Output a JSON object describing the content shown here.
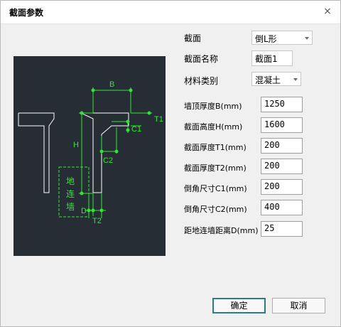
{
  "window": {
    "title": "截面参数",
    "close_glyph": "×"
  },
  "diagram": {
    "label_b": "B",
    "label_h": "H",
    "label_t1": "T1",
    "label_t2": "T2",
    "label_c1": "C1",
    "label_c2": "C2",
    "label_d": "D",
    "wall_chars": [
      "地",
      "连",
      "墙"
    ],
    "colors": {
      "background": "#262d35",
      "outline": "#ffffff",
      "dimension": "#33e533"
    }
  },
  "form": {
    "section_label": "截面",
    "section_value": "倒L形",
    "name_label": "截面名称",
    "name_value": "截面1",
    "material_label": "材料类别",
    "material_value": "混凝土",
    "fields": [
      {
        "label": "墙顶厚度B(mm)",
        "value": "1250"
      },
      {
        "label": "截面高度H(mm)",
        "value": "1600"
      },
      {
        "label": "截面厚度T1(mm)",
        "value": "200"
      },
      {
        "label": "截面厚度T2(mm)",
        "value": "200"
      },
      {
        "label": "倒角尺寸C1(mm)",
        "value": "200"
      },
      {
        "label": "倒角尺寸C2(mm)",
        "value": "400"
      },
      {
        "label": "距地连墙距离D(mm)",
        "value": "25"
      }
    ]
  },
  "buttons": {
    "ok": "确定",
    "cancel": "取消"
  }
}
